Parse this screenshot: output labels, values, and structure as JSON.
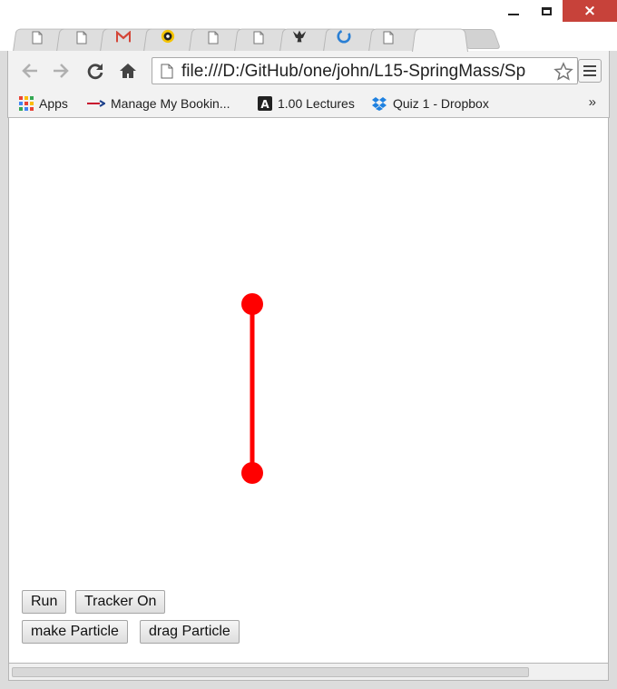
{
  "window": {
    "controls": {
      "minimize": "minimize",
      "maximize": "maximize",
      "close": "×"
    }
  },
  "tabs": [
    {
      "icon": "page-icon"
    },
    {
      "icon": "page-icon"
    },
    {
      "icon": "gmail-icon"
    },
    {
      "icon": "eye-icon"
    },
    {
      "icon": "page-icon"
    },
    {
      "icon": "page-icon"
    },
    {
      "icon": "eagle-icon"
    },
    {
      "icon": "swirl-icon"
    },
    {
      "icon": "page-icon"
    },
    {
      "icon": "page-icon",
      "active": true,
      "close": "×"
    }
  ],
  "toolbar": {
    "url": "file:///D:/GitHub/one/john/L15-SpringMass/Sp"
  },
  "bookmarks": {
    "items": [
      {
        "label": "Apps",
        "icon": "apps-grid-icon"
      },
      {
        "label": "Manage My Bookin...",
        "icon": "airline-icon"
      },
      {
        "label": "1.00 Lectures",
        "icon": "a-logo-icon"
      },
      {
        "label": "Quiz 1 - Dropbox",
        "icon": "dropbox-icon"
      }
    ],
    "overflow": "»"
  },
  "page": {
    "buttons": {
      "run": "Run",
      "tracker": "Tracker On",
      "make_particle": "make Particle",
      "drag_particle": "drag Particle"
    },
    "colors": {
      "particle": "#ff0000",
      "spring": "#ff0000"
    }
  }
}
